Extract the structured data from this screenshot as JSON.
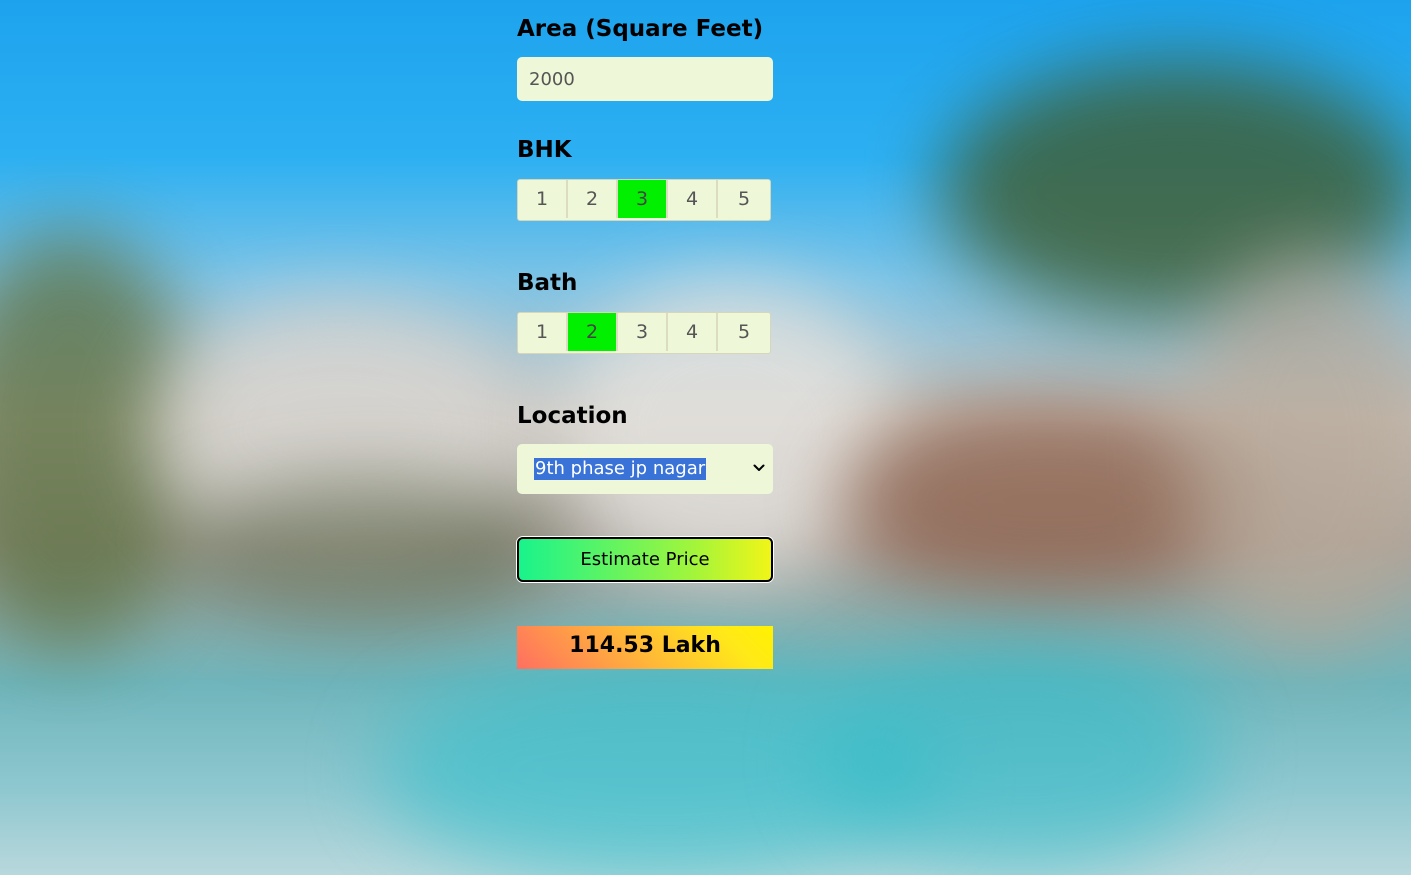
{
  "form": {
    "area": {
      "label": "Area (Square Feet)",
      "value": "2000"
    },
    "bhk": {
      "label": "BHK",
      "options": [
        "1",
        "2",
        "3",
        "4",
        "5"
      ],
      "selected": "3"
    },
    "bath": {
      "label": "Bath",
      "options": [
        "1",
        "2",
        "3",
        "4",
        "5"
      ],
      "selected": "2"
    },
    "location": {
      "label": "Location",
      "selected": "9th phase jp nagar"
    },
    "estimate_button": "Estimate Price",
    "result": "114.53 Lakh"
  },
  "colors": {
    "field_bg": "#eef7d8",
    "active_option": "#00f000",
    "selection_highlight": "#3a73d8"
  }
}
